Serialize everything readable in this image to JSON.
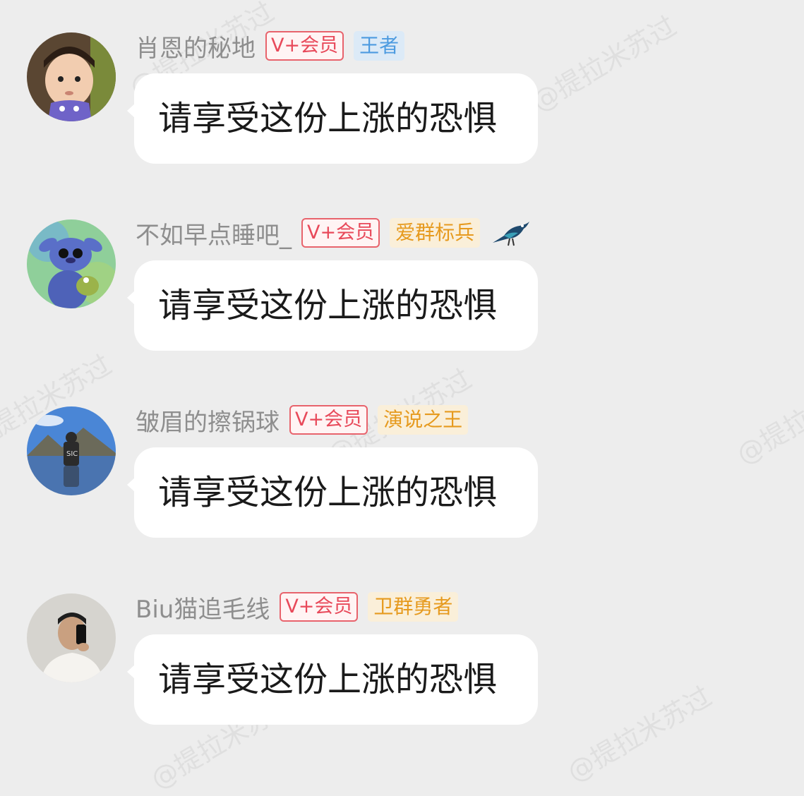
{
  "messages": [
    {
      "username": "肖恩的秘地",
      "vip": "V+会员",
      "title": "王者",
      "title_style": "blue",
      "text": "请享受这份上涨的恐惧",
      "avatar_icon": "baby-avatar-icon"
    },
    {
      "username": "不如早点睡吧_",
      "vip": "V+会员",
      "title": "爱群标兵",
      "title_style": "gold",
      "text": "请享受这份上涨的恐惧",
      "avatar_icon": "stitch-avatar-icon",
      "extra_icon": "bird-icon"
    },
    {
      "username": "皱眉的擦锅球",
      "vip": "V+会员",
      "title": "演说之王",
      "title_style": "gold",
      "text": "请享受这份上涨的恐惧",
      "avatar_icon": "landscape-avatar-icon"
    },
    {
      "username": "Biu猫追毛线",
      "vip": "V+会员",
      "title": "卫群勇者",
      "title_style": "gold",
      "text": "请享受这份上涨的恐惧",
      "avatar_icon": "selfie-avatar-icon"
    }
  ],
  "watermark": "@提拉米苏过"
}
